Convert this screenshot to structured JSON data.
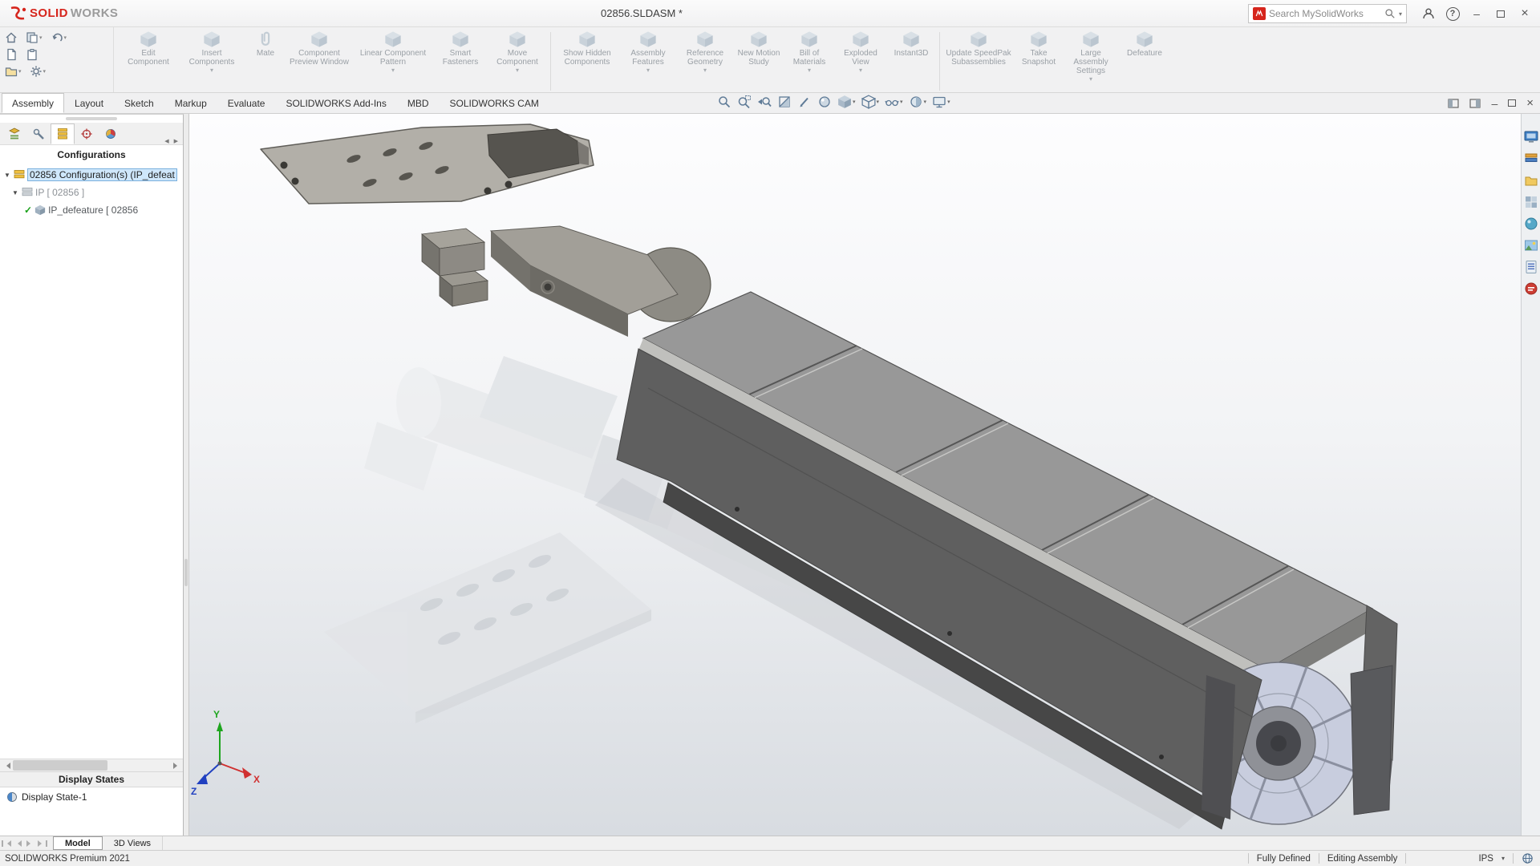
{
  "brand": {
    "solid": "SOLID",
    "works": "WORKS"
  },
  "window": {
    "title": "02856.SLDASM *"
  },
  "search": {
    "placeholder": "Search MySolidWorks"
  },
  "glyphs": {
    "minimize": "–",
    "close": "×",
    "help": "?",
    "dropdown": "▾",
    "collapse_up": "▴",
    "check": "✓",
    "tree_expand_open": "▼",
    "panel_tab_overflow": "◀ ▶"
  },
  "ribbon": {
    "buttons": [
      {
        "label": "Edit Component",
        "caret": ""
      },
      {
        "label": "Insert Components",
        "caret": "▾"
      },
      {
        "label": "Mate",
        "caret": ""
      },
      {
        "label": "Component Preview Window",
        "caret": ""
      },
      {
        "label": "Linear Component Pattern",
        "caret": "▾"
      },
      {
        "label": "Smart Fasteners",
        "caret": ""
      },
      {
        "label": "Move Component",
        "caret": "▾"
      },
      {
        "label": "Show Hidden Components",
        "caret": ""
      },
      {
        "label": "Assembly Features",
        "caret": "▾"
      },
      {
        "label": "Reference Geometry",
        "caret": "▾"
      },
      {
        "label": "New Motion Study",
        "caret": ""
      },
      {
        "label": "Bill of Materials",
        "caret": "▾"
      },
      {
        "label": "Exploded View",
        "caret": "▾"
      },
      {
        "label": "Instant3D",
        "caret": ""
      },
      {
        "label": "Update SpeedPak Subassemblies",
        "caret": ""
      },
      {
        "label": "Take Snapshot",
        "caret": ""
      },
      {
        "label": "Large Assembly Settings",
        "caret": "▾"
      },
      {
        "label": "Defeature",
        "caret": ""
      }
    ]
  },
  "tabs": {
    "items": [
      "Assembly",
      "Layout",
      "Sketch",
      "Markup",
      "Evaluate",
      "SOLIDWORKS Add-Ins",
      "MBD",
      "SOLIDWORKS CAM"
    ],
    "active": "Assembly"
  },
  "hud": {
    "icons": [
      "zoom-to-fit",
      "zoom-to-area",
      "previous-view",
      "section-view",
      "annotation",
      "apply-scene",
      "view-orientation",
      "display-style",
      "hide-show-items",
      "edit-appearance",
      "view-settings"
    ]
  },
  "panel": {
    "configurations_header": "Configurations",
    "tree": {
      "root_label": "02856 Configuration(s)  (IP_defeat",
      "child_label": "IP [ 02856 ]",
      "grandchild_label": "IP_defeature [ 02856"
    },
    "display_states_header": "Display States",
    "display_state_label": "Display State-1"
  },
  "taskpane": {
    "icons": [
      "solidworks-resources",
      "design-library",
      "file-explorer",
      "view-palette",
      "appearances-scenes",
      "scene-illumination",
      "custom-properties",
      "solidworks-forum"
    ]
  },
  "doc_tabs": {
    "model": "Model",
    "views": "3D Views"
  },
  "statusbar": {
    "app": "SOLIDWORKS Premium 2021",
    "defined": "Fully Defined",
    "mode": "Editing Assembly",
    "units": "IPS"
  },
  "triad": {
    "x": "X",
    "y": "Y",
    "z": "Z"
  }
}
